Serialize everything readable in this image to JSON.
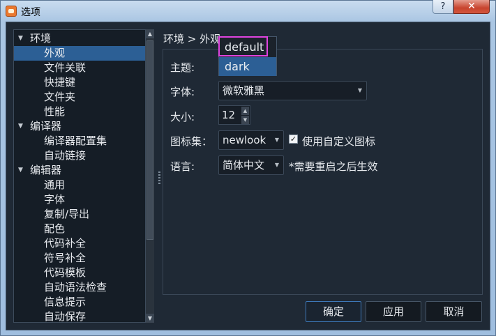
{
  "window": {
    "title": "选项",
    "help_glyph": "?",
    "close_glyph": "✕"
  },
  "tree": {
    "items": [
      {
        "label": "环境",
        "level": 0,
        "expanded": true
      },
      {
        "label": "外观",
        "level": 1,
        "selected": true
      },
      {
        "label": "文件关联",
        "level": 1
      },
      {
        "label": "快捷键",
        "level": 1
      },
      {
        "label": "文件夹",
        "level": 1
      },
      {
        "label": "性能",
        "level": 1
      },
      {
        "label": "编译器",
        "level": 0,
        "expanded": true
      },
      {
        "label": "编译器配置集",
        "level": 1
      },
      {
        "label": "自动链接",
        "level": 1
      },
      {
        "label": "编辑器",
        "level": 0,
        "expanded": true
      },
      {
        "label": "通用",
        "level": 1
      },
      {
        "label": "字体",
        "level": 1
      },
      {
        "label": "复制/导出",
        "level": 1
      },
      {
        "label": "配色",
        "level": 1
      },
      {
        "label": "代码补全",
        "level": 1
      },
      {
        "label": "符号补全",
        "level": 1
      },
      {
        "label": "代码模板",
        "level": 1
      },
      {
        "label": "自动语法检查",
        "level": 1
      },
      {
        "label": "信息提示",
        "level": 1
      },
      {
        "label": "自动保存",
        "level": 1
      }
    ],
    "expand_glyph": "▼",
    "scroll_up_glyph": "▲",
    "scroll_down_glyph": "▼"
  },
  "panel": {
    "breadcrumb": "环境 > 外观",
    "theme_label": "主题:",
    "font_label": "字体:",
    "font_value": "微软雅黑",
    "size_label": "大小:",
    "size_value": "12",
    "iconset_label": "图标集：",
    "iconset_value": "newlook",
    "custom_icons_label": "使用自定义图标",
    "custom_icons_checked": true,
    "check_glyph": "✓",
    "language_label": "语言:",
    "language_value": "简体中文",
    "language_note": "*需要重启之后生效",
    "caret_glyph": "▼"
  },
  "theme_dropdown": {
    "options": [
      "default",
      "dark"
    ],
    "highlighted": "dark"
  },
  "buttons": {
    "ok": "确定",
    "apply": "应用",
    "cancel": "取消"
  },
  "colors": {
    "selection": "#2c5f95",
    "annotation": "#e044e0",
    "close_button": "#c8442e"
  }
}
